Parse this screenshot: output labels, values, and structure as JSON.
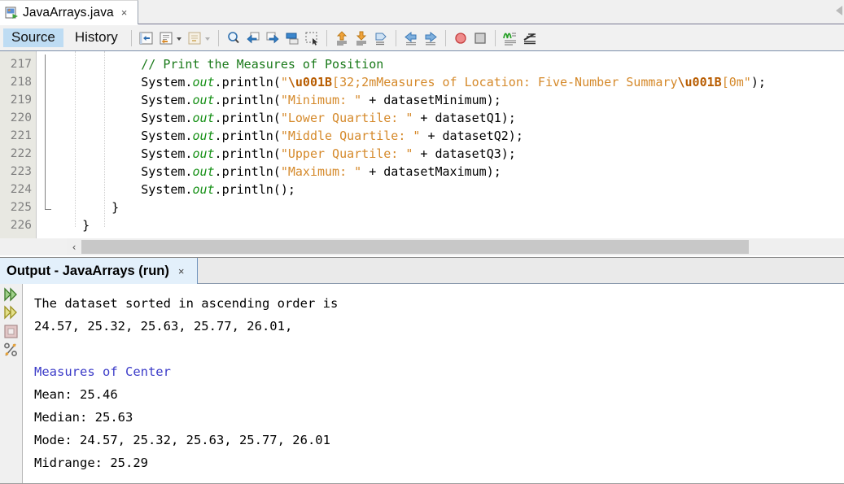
{
  "window": {
    "file_tab": {
      "name": "JavaArrays.java",
      "icon": "java-file-icon",
      "close_label": "×"
    },
    "tab_overflow_icon": "left-arrow-icon"
  },
  "toolbar": {
    "view_tabs": [
      {
        "label": "Source",
        "active": true
      },
      {
        "label": "History",
        "active": false
      }
    ],
    "buttons": [
      {
        "name": "last-edit-icon"
      },
      {
        "name": "find-selection-icon"
      },
      {
        "name": "find-selection-dropdown-caret"
      },
      {
        "name": "toggle-rect-selection-icon"
      },
      {
        "name": "toggle-rect-dropdown-caret"
      },
      {
        "name": "zoom-icon"
      },
      {
        "name": "back-icon"
      },
      {
        "name": "forward-icon"
      },
      {
        "name": "shift-line-left-icon"
      },
      {
        "name": "rectangular-selection-icon"
      },
      {
        "name": "previous-bookmark-icon"
      },
      {
        "name": "next-bookmark-icon"
      },
      {
        "name": "toggle-bookmark-icon"
      },
      {
        "name": "shift-left-icon"
      },
      {
        "name": "shift-right-icon"
      },
      {
        "name": "toggle-breakpoint-icon"
      },
      {
        "name": "stop-icon"
      },
      {
        "name": "inspect-members-icon"
      },
      {
        "name": "inspect-hierarchy-icon"
      }
    ]
  },
  "editor": {
    "first_line": 217,
    "lines": [
      {
        "number": 217,
        "indent": 12,
        "tokens": [
          {
            "t": "// Print the Measures of Position",
            "c": "c-cmt"
          }
        ]
      },
      {
        "number": 218,
        "indent": 12,
        "tokens": [
          {
            "t": "System.",
            "c": "c-plain"
          },
          {
            "t": "out",
            "c": "c-fld"
          },
          {
            "t": ".println(",
            "c": "c-plain"
          },
          {
            "t": "\"",
            "c": "c-str"
          },
          {
            "t": "\\u001B",
            "c": "c-esc"
          },
          {
            "t": "[32;2mMeasures of Location: Five-Number Summary",
            "c": "c-str"
          },
          {
            "t": "\\u001B",
            "c": "c-esc"
          },
          {
            "t": "[0m\"",
            "c": "c-str"
          },
          {
            "t": ");",
            "c": "c-plain"
          }
        ]
      },
      {
        "number": 219,
        "indent": 12,
        "tokens": [
          {
            "t": "System.",
            "c": "c-plain"
          },
          {
            "t": "out",
            "c": "c-fld"
          },
          {
            "t": ".println(",
            "c": "c-plain"
          },
          {
            "t": "\"Minimum: \"",
            "c": "c-str"
          },
          {
            "t": " + datasetMinimum);",
            "c": "c-plain"
          }
        ]
      },
      {
        "number": 220,
        "indent": 12,
        "tokens": [
          {
            "t": "System.",
            "c": "c-plain"
          },
          {
            "t": "out",
            "c": "c-fld"
          },
          {
            "t": ".println(",
            "c": "c-plain"
          },
          {
            "t": "\"Lower Quartile: \"",
            "c": "c-str"
          },
          {
            "t": " + datasetQ1);",
            "c": "c-plain"
          }
        ]
      },
      {
        "number": 221,
        "indent": 12,
        "tokens": [
          {
            "t": "System.",
            "c": "c-plain"
          },
          {
            "t": "out",
            "c": "c-fld"
          },
          {
            "t": ".println(",
            "c": "c-plain"
          },
          {
            "t": "\"Middle Quartile: \"",
            "c": "c-str"
          },
          {
            "t": " + datasetQ2);",
            "c": "c-plain"
          }
        ]
      },
      {
        "number": 222,
        "indent": 12,
        "tokens": [
          {
            "t": "System.",
            "c": "c-plain"
          },
          {
            "t": "out",
            "c": "c-fld"
          },
          {
            "t": ".println(",
            "c": "c-plain"
          },
          {
            "t": "\"Upper Quartile: \"",
            "c": "c-str"
          },
          {
            "t": " + datasetQ3);",
            "c": "c-plain"
          }
        ]
      },
      {
        "number": 223,
        "indent": 12,
        "tokens": [
          {
            "t": "System.",
            "c": "c-plain"
          },
          {
            "t": "out",
            "c": "c-fld"
          },
          {
            "t": ".println(",
            "c": "c-plain"
          },
          {
            "t": "\"Maximum: \"",
            "c": "c-str"
          },
          {
            "t": " + datasetMaximum);",
            "c": "c-plain"
          }
        ]
      },
      {
        "number": 224,
        "indent": 12,
        "tokens": [
          {
            "t": "System.",
            "c": "c-plain"
          },
          {
            "t": "out",
            "c": "c-fld"
          },
          {
            "t": ".println();",
            "c": "c-plain"
          }
        ]
      },
      {
        "number": 225,
        "indent": 8,
        "tokens": [
          {
            "t": "}",
            "c": "c-plain"
          }
        ]
      },
      {
        "number": 226,
        "indent": 4,
        "tokens": [
          {
            "t": "}",
            "c": "c-plain"
          }
        ]
      }
    ],
    "scrollbar": {
      "left_button_glyph": "‹"
    }
  },
  "output": {
    "tab_title": "Output - JavaArrays (run)",
    "close_label": "×",
    "rail_buttons": [
      {
        "name": "rerun-icon"
      },
      {
        "name": "rerun-alt-icon"
      },
      {
        "name": "stop-process-icon"
      },
      {
        "name": "io-settings-icon"
      }
    ],
    "lines": [
      {
        "text": "The dataset sorted in ascending order is",
        "color": "default"
      },
      {
        "text": "24.57, 25.32, 25.63, 25.77, 26.01,",
        "color": "default"
      },
      {
        "text": "",
        "color": "default"
      },
      {
        "text": "Measures of Center",
        "color": "blue"
      },
      {
        "text": "Mean: 25.46",
        "color": "default"
      },
      {
        "text": "Median: 25.63",
        "color": "default"
      },
      {
        "text": "Mode: 24.57, 25.32, 25.63, 25.77, 26.01",
        "color": "default"
      },
      {
        "text": "Midrange: 25.29",
        "color": "default"
      }
    ]
  },
  "colors": {
    "accent_tab": "#bedcf3",
    "output_tab": "#e3f0fb",
    "comment_green": "#1a7a1a",
    "string_orange": "#d5892a",
    "escape_orange": "#b85c00",
    "field_green": "#169016",
    "ansi_blue": "#3b3bc8"
  }
}
